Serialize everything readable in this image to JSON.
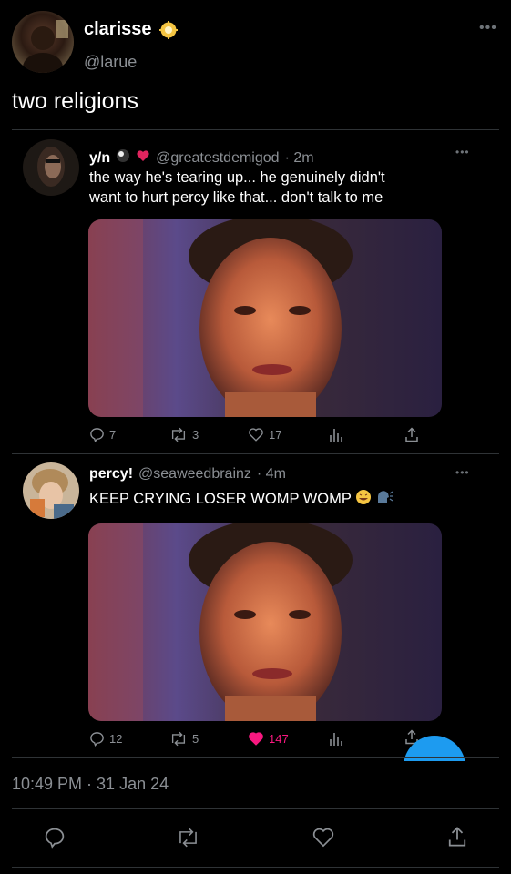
{
  "main_tweet": {
    "author_name": "clarisse",
    "author_handle": "@larue",
    "text": "two religions",
    "timestamp": "10:49 PM · 31 Jan 24"
  },
  "quoted": [
    {
      "author_name": "y/n",
      "author_handle": "@greatestdemigod",
      "time": "· 2m",
      "text_line1": "the way he's tearing up... he genuinely didn't",
      "text_line2": "want to hurt percy like that... don't talk to me",
      "replies": "7",
      "retweets": "3",
      "likes": "17",
      "liked": false
    },
    {
      "author_name": "percy!",
      "author_handle": "@seaweedbrainz",
      "time": "· 4m",
      "text_line1": "KEEP CRYING LOSER WOMP WOMP",
      "text_line2": "",
      "replies": "12",
      "retweets": "5",
      "likes": "147",
      "liked": true
    }
  ],
  "colors": {
    "background": "#000000",
    "muted": "#8b8f94",
    "like_active": "#f91880",
    "accent": "#1d9bf0",
    "verified_badge": "#f5c542"
  },
  "icons": {
    "more": "more-dots-icon",
    "reply": "reply-icon",
    "retweet": "retweet-icon",
    "like": "like-icon",
    "analytics": "analytics-icon",
    "share": "share-icon"
  }
}
